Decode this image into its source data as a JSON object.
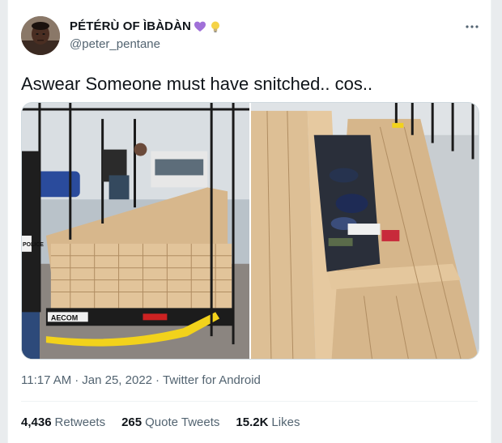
{
  "tweet": {
    "display_name": "PÉTÉRÙ OF ÌBÀDÀN",
    "handle": "@peter_pentane",
    "text": "Aswear Someone must have snitched.. cos..",
    "time": "11:17 AM",
    "separator": "·",
    "date": "Jan 25, 2022",
    "source": "Twitter for Android",
    "emojis": [
      "purple-heart",
      "light-bulb"
    ],
    "more_icon": "more-horizontal-icon"
  },
  "stats": {
    "retweets_count": "4,436",
    "retweets_label": "Retweets",
    "quote_count": "265",
    "quote_label": "Quote Tweets",
    "likes_count": "15.2K",
    "likes_label": "Likes"
  },
  "colors": {
    "text_primary": "#0f1419",
    "text_secondary": "#536471",
    "border": "#cfd9de",
    "heart": "#a070d8",
    "bulb": "#f5d347"
  },
  "media": {
    "photo_1_text": "AECOM",
    "photo_1_badge": "POLICE"
  }
}
